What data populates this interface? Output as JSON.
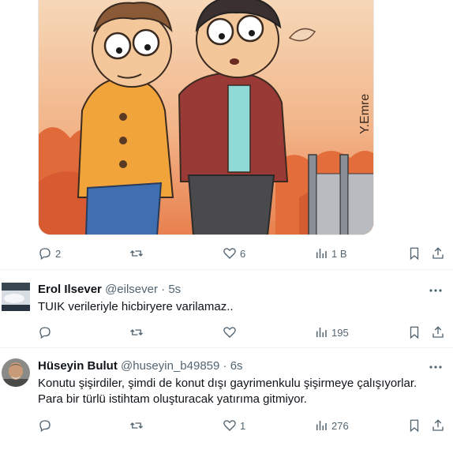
{
  "media": {
    "signature": "Y.Emre"
  },
  "tweet0": {
    "reply_count": "2",
    "retweet_count": "",
    "like_count": "6",
    "view_count": "1 B"
  },
  "tweet1": {
    "display_name": "Erol Ilsever",
    "handle": "@eilsever",
    "separator": "·",
    "time": "5s",
    "text": "TUIK verileriyle hicbiryere varilamaz..",
    "reply_count": "",
    "retweet_count": "",
    "like_count": "",
    "view_count": "195"
  },
  "tweet2": {
    "display_name": "Hüseyin Bulut",
    "handle": "@huseyin_b49859",
    "separator": "·",
    "time": "6s",
    "text_line1": "Konutu şişirdiler, şimdi de konut dışı gayrimenkulu şişirmeye çalışıyorlar.",
    "text_line2": "Para bir türlü istihtam oluşturacak yatırıma gitmiyor.",
    "reply_count": "",
    "retweet_count": "",
    "like_count": "1",
    "view_count": "276"
  },
  "colors": {
    "icon_gray": "#536471",
    "text": "#0f1419",
    "divider": "#eff3f4"
  }
}
